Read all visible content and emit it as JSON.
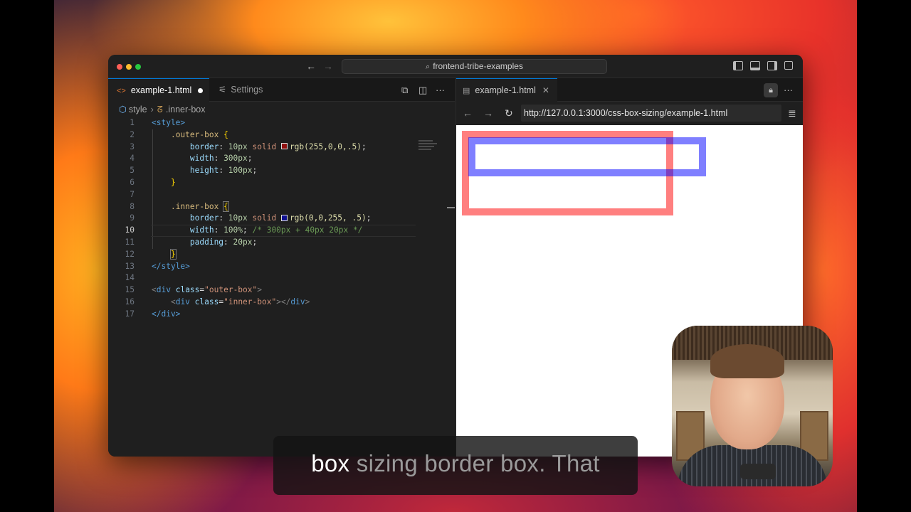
{
  "window": {
    "command_center": "frontend-tribe-examples"
  },
  "editor": {
    "tabs": [
      {
        "label": "example-1.html",
        "active": true,
        "unsaved": true
      },
      {
        "label": "Settings",
        "active": false
      }
    ],
    "breadcrumb": [
      "style",
      ".inner-box"
    ],
    "current_line": 10,
    "line_numbers": [
      "1",
      "2",
      "3",
      "4",
      "5",
      "6",
      "7",
      "8",
      "9",
      "10",
      "11",
      "12",
      "13",
      "14",
      "15",
      "16",
      "17"
    ],
    "code": {
      "l1": "<style>",
      "l2_sel": ".outer-box",
      "l3_prop": "border",
      "l3_num": "10px",
      "l3_val": "solid",
      "l3_rgb": "rgb(255,0,0,.5)",
      "l4_prop": "width",
      "l4_num": "300px",
      "l5_prop": "height",
      "l5_num": "100px",
      "l8_sel": ".inner-box",
      "l9_prop": "border",
      "l9_num": "10px",
      "l9_val": "solid",
      "l9_rgb": "rgb(0,0,255, .5)",
      "l10_prop": "width",
      "l10_num": "100%",
      "l10_comment": "/* 300px + 40px 20px */",
      "l11_prop": "padding",
      "l11_num": "20px",
      "l13": "</style>",
      "l15_tag": "div",
      "l15_attr": "class",
      "l15_str": "\"outer-box\"",
      "l16_tag": "div",
      "l16_attr": "class",
      "l16_str": "\"inner-box\"",
      "l16_close": "div",
      "l17": "</div>"
    }
  },
  "browser": {
    "tab_label": "example-1.html",
    "url": "http://127.0.0.1:3000/css-box-sizing/example-1.html"
  },
  "caption": {
    "highlight": "box",
    "rest": " sizing border box. That"
  },
  "colors": {
    "outer_border": "rgba(255,0,0,0.5)",
    "inner_border": "rgba(0,0,255,0.5)",
    "accent": "#0078d4"
  },
  "icons": [
    "search-icon",
    "back-arrow-icon",
    "forward-arrow-icon",
    "reload-icon",
    "lock-icon",
    "close-icon",
    "split-editor-icon",
    "more-icon",
    "layout-icon",
    "html-file-icon",
    "settings-icon"
  ]
}
